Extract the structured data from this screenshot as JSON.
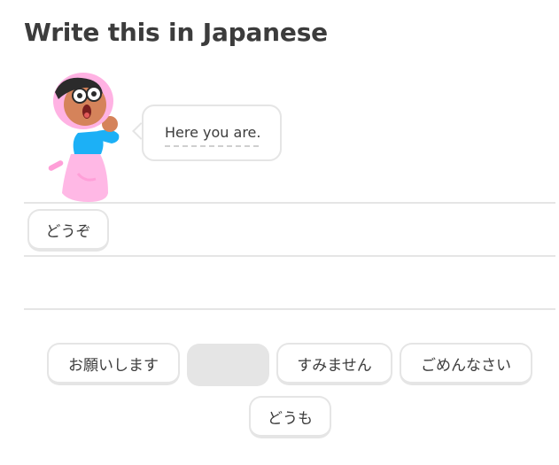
{
  "exercise": {
    "title": "Write this in Japanese"
  },
  "prompt": {
    "text": "Here you are."
  },
  "answer": {
    "selected": [
      "どうぞ"
    ]
  },
  "word_bank": {
    "words": [
      "お願いします",
      "",
      "すみません",
      "ごめんなさい",
      "どうも"
    ]
  },
  "colors": {
    "text": "#3c3c3c",
    "border": "#e5e5e5",
    "character_skin": "#d5835a",
    "character_hood": "#ffb2e3",
    "character_shirt": "#1cb0f6"
  },
  "icons": {
    "character": "duolingo-character-lily"
  }
}
